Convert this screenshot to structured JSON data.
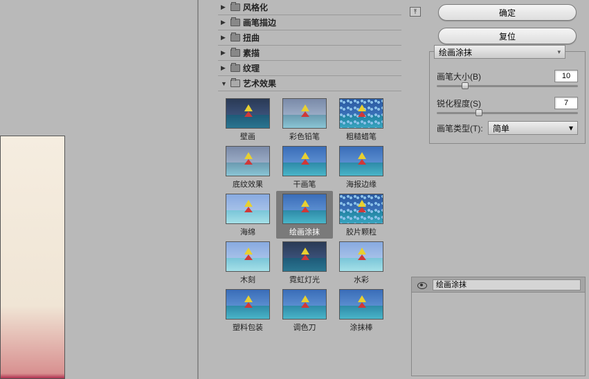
{
  "categories": [
    {
      "label": "风格化",
      "expanded": false
    },
    {
      "label": "画笔描边",
      "expanded": false
    },
    {
      "label": "扭曲",
      "expanded": false
    },
    {
      "label": "素描",
      "expanded": false
    },
    {
      "label": "纹理",
      "expanded": false
    },
    {
      "label": "艺术效果",
      "expanded": true
    }
  ],
  "thumbs": [
    {
      "label": "壁画",
      "cls": "tsky dark"
    },
    {
      "label": "彩色铅笔",
      "cls": "tsky gray"
    },
    {
      "label": "粗糙蜡笔",
      "cls": "tsky dots"
    },
    {
      "label": "底纹效果",
      "cls": "tsky gray"
    },
    {
      "label": "干画笔",
      "cls": "tsky"
    },
    {
      "label": "海报边缘",
      "cls": "tsky"
    },
    {
      "label": "海绵",
      "cls": "tsky light"
    },
    {
      "label": "绘画涂抹",
      "cls": "tsky",
      "selected": true
    },
    {
      "label": "胶片颗粒",
      "cls": "tsky dots"
    },
    {
      "label": "木刻",
      "cls": "tsky light"
    },
    {
      "label": "霓虹灯光",
      "cls": "tsky dark"
    },
    {
      "label": "水彩",
      "cls": "tsky light"
    },
    {
      "label": "塑料包装",
      "cls": "tsky"
    },
    {
      "label": "调色刀",
      "cls": "tsky"
    },
    {
      "label": "涂抹棒",
      "cls": "tsky"
    }
  ],
  "buttons": {
    "ok": "确定",
    "reset": "复位"
  },
  "current_filter": "绘画涂抹",
  "params": {
    "brush_size_label": "画笔大小(B)",
    "brush_size_value": "10",
    "sharpen_label": "锐化程度(S)",
    "sharpen_value": "7",
    "brush_type_label": "画笔类型(T):",
    "brush_type_value": "简单"
  },
  "layer": {
    "name": "绘画涂抹"
  },
  "collapse_glyph": "⤒"
}
